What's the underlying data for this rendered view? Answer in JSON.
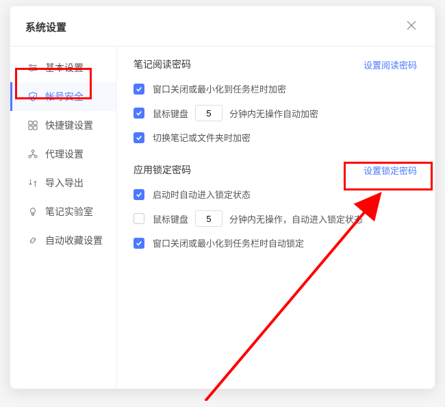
{
  "header": {
    "title": "系统设置"
  },
  "sidebar": {
    "items": [
      {
        "label": "基本设置"
      },
      {
        "label": "帐号安全"
      },
      {
        "label": "快捷键设置"
      },
      {
        "label": "代理设置"
      },
      {
        "label": "导入导出"
      },
      {
        "label": "笔记实验室"
      },
      {
        "label": "自动收藏设置"
      }
    ]
  },
  "readPwd": {
    "title": "笔记阅读密码",
    "link": "设置阅读密码",
    "opt1": "窗口关闭或最小化到任务栏时加密",
    "opt2a": "鼠标键盘",
    "opt2min": "5",
    "opt2b": "分钟内无操作自动加密",
    "opt3": "切换笔记或文件夹时加密"
  },
  "lockPwd": {
    "title": "应用锁定密码",
    "link": "设置锁定密码",
    "opt1": "启动时自动进入锁定状态",
    "opt2a": "鼠标键盘",
    "opt2min": "5",
    "opt2b": "分钟内无操作，自动进入锁定状态",
    "opt3": "窗口关闭或最小化到任务栏时自动锁定"
  }
}
